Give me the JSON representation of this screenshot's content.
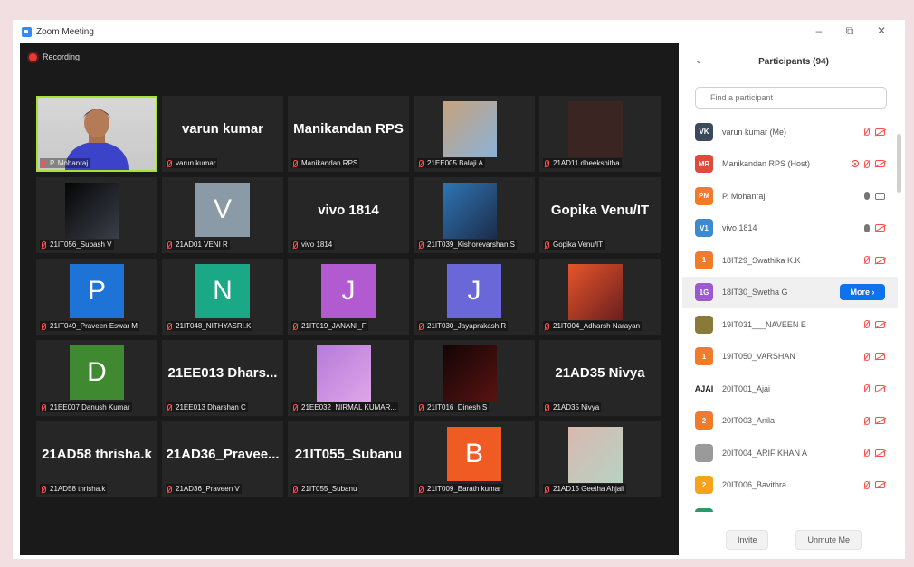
{
  "window": {
    "title": "Zoom Meeting",
    "min": "–",
    "max": "⧉",
    "close": "✕"
  },
  "meeting": {
    "recording_label": "Recording"
  },
  "tiles": [
    {
      "label": "P. Mohanraj",
      "kind": "video"
    },
    {
      "name": "varun kumar",
      "label": "varun kumar",
      "kind": "name"
    },
    {
      "name": "Manikandan RPS",
      "label": "Manikandan RPS",
      "kind": "name"
    },
    {
      "label": "21EE005 Balaji A",
      "kind": "photo",
      "colors": [
        "#c6a27c",
        "#8bb2d8"
      ]
    },
    {
      "label": "21AD11 dheekshitha",
      "kind": "photo",
      "colors": [
        "#3a2522",
        "#3a2522"
      ]
    },
    {
      "label": "21IT056_Subash V",
      "kind": "photo",
      "colors": [
        "#050505",
        "#3a3f4a"
      ]
    },
    {
      "label": "21AD01 VENI R",
      "kind": "avatar",
      "initial": "V",
      "color": "#8a9aa6"
    },
    {
      "name": "vivo 1814",
      "label": "vivo 1814",
      "kind": "name"
    },
    {
      "label": "21IT039_Kishorevarshan S",
      "kind": "photo",
      "colors": [
        "#2e76b5",
        "#1c2c4a"
      ]
    },
    {
      "name": "Gopika Venu/IT",
      "label": "Gopika Venu/IT",
      "kind": "name"
    },
    {
      "label": "21IT049_Praveen Eswar M",
      "kind": "avatar",
      "initial": "P",
      "color": "#1d73d6"
    },
    {
      "label": "21IT048_NITHYASRI.K",
      "kind": "avatar",
      "initial": "N",
      "color": "#1aa886"
    },
    {
      "label": "21IT019_JANANI_F",
      "kind": "avatar",
      "initial": "J",
      "color": "#b25ad0"
    },
    {
      "label": "21IT030_Jayaprakash.R",
      "kind": "avatar",
      "initial": "J",
      "color": "#6a67d8"
    },
    {
      "label": "21IT004_Adharsh Narayan",
      "kind": "photo",
      "colors": [
        "#e6552b",
        "#6b1e1e"
      ]
    },
    {
      "label": "21EE007 Danush Kumar",
      "kind": "avatar",
      "initial": "D",
      "color": "#3f8a30"
    },
    {
      "name": "21EE013 Dhars...",
      "label": "21EE013 Dharshan C",
      "kind": "name"
    },
    {
      "label": "21EE032_NIRMAL KUMAR...",
      "kind": "photo",
      "colors": [
        "#b57ad9",
        "#e0a6e9"
      ]
    },
    {
      "label": "21IT016_Dinesh S",
      "kind": "photo",
      "colors": [
        "#120505",
        "#5a1212"
      ]
    },
    {
      "name": "21AD35 Nivya",
      "label": "21AD35 Nivya",
      "kind": "name"
    },
    {
      "name": "21AD58 thrisha.k",
      "label": "21AD58 thrisha.k",
      "kind": "name"
    },
    {
      "name": "21AD36_Pravee...",
      "label": "21AD36_Praveen V",
      "kind": "name"
    },
    {
      "name": "21IT055_Subanu",
      "label": "21IT055_Subanu",
      "kind": "name"
    },
    {
      "label": "21IT009_Barath kumar",
      "kind": "avatar",
      "initial": "B",
      "color": "#f05a23"
    },
    {
      "label": "21AD15 Geetha Ahjali",
      "kind": "photo",
      "colors": [
        "#d9b8b0",
        "#b7d2c2"
      ]
    }
  ],
  "participants": {
    "title": "Participants (94)",
    "collapse": "⌄",
    "search_placeholder": "Find a participant",
    "more_label": "More ›",
    "invite_label": "Invite",
    "unmute_label": "Unmute Me",
    "list": [
      {
        "initials": "VK",
        "color": "#3a4a5c",
        "name": "varun kumar (Me)",
        "icons": "mic-off cam-off"
      },
      {
        "initials": "MR",
        "color": "#e04a3c",
        "name": "Manikandan RPS (Host)",
        "icons": "rec mic-off cam-off"
      },
      {
        "initials": "PM",
        "color": "#f07b2b",
        "name": "P. Mohanraj",
        "icons": "mic cam"
      },
      {
        "initials": "V1",
        "color": "#3d8ad1",
        "name": "vivo 1814",
        "icons": "mic cam-off"
      },
      {
        "initials": "1",
        "color": "#f07b2b",
        "name": "18IT29_Swathika K.K",
        "icons": "mic-off cam-off"
      },
      {
        "initials": "1G",
        "color": "#9c5ad0",
        "name": "18IT30_Swetha G",
        "icons": "more",
        "highlight": true
      },
      {
        "initials": "",
        "color": "#8a7a3a",
        "name": "19IT031___NAVEEN E",
        "icons": "mic-off cam-off"
      },
      {
        "initials": "1",
        "color": "#f07b2b",
        "name": "19IT050_VARSHAN",
        "icons": "mic-off cam-off"
      },
      {
        "initials": "AJAI",
        "color": "#ffffff",
        "name": "20IT001_Ajai",
        "icons": "mic-off cam-off"
      },
      {
        "initials": "2",
        "color": "#f07b2b",
        "name": "20IT003_Anila",
        "icons": "mic-off cam-off"
      },
      {
        "initials": "",
        "color": "#9a9a9a",
        "name": "20IT004_ARIF KHAN A",
        "icons": "mic-off cam-off"
      },
      {
        "initials": "2",
        "color": "#f5a31a",
        "name": "20IT006_Bavithra",
        "icons": "mic-off cam-off"
      },
      {
        "initials": "",
        "color": "#2a9a6a",
        "name": "",
        "icons": "mic-off cam-off"
      }
    ]
  }
}
